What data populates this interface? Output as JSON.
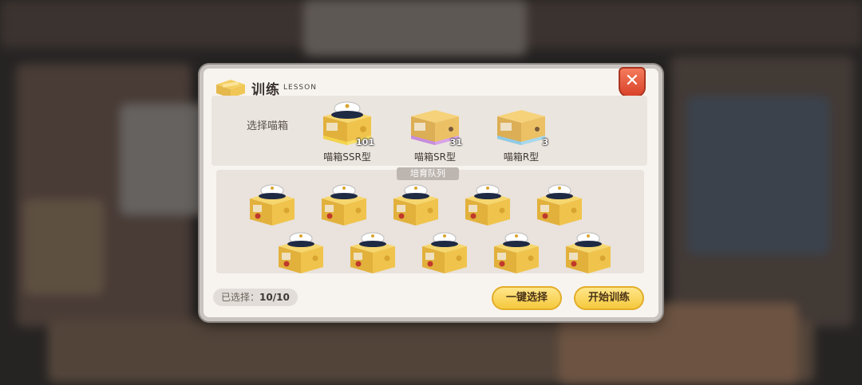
{
  "dialog": {
    "title": "训练",
    "subtitle": "LESSON",
    "close_label": "✕"
  },
  "select_section": {
    "label": "选择喵箱",
    "box_types": [
      {
        "name": "喵箱SSR型",
        "count": "101",
        "accent": "#f4d44c",
        "hat": true
      },
      {
        "name": "喵箱SR型",
        "count": "31",
        "accent": "#c68ce0",
        "hat": false
      },
      {
        "name": "喵箱R型",
        "count": "3",
        "accent": "#8fcbe8",
        "hat": false
      }
    ]
  },
  "queue": {
    "label": "培育队列",
    "items": [
      {
        "type": "SSR"
      },
      {
        "type": "SSR"
      },
      {
        "type": "SSR"
      },
      {
        "type": "SSR"
      },
      {
        "type": "SSR"
      },
      {
        "type": "SSR"
      },
      {
        "type": "SSR"
      },
      {
        "type": "SSR"
      },
      {
        "type": "SSR"
      },
      {
        "type": "SSR"
      }
    ]
  },
  "footer": {
    "selected_label": "已选择：",
    "selected_value": "10/10",
    "auto_select_button": "一键选择",
    "start_training_button": "开始训练"
  },
  "colors": {
    "gold_box": "#e8b93a",
    "close_button": "#e4573a",
    "primary_button": "#f7d14d"
  }
}
